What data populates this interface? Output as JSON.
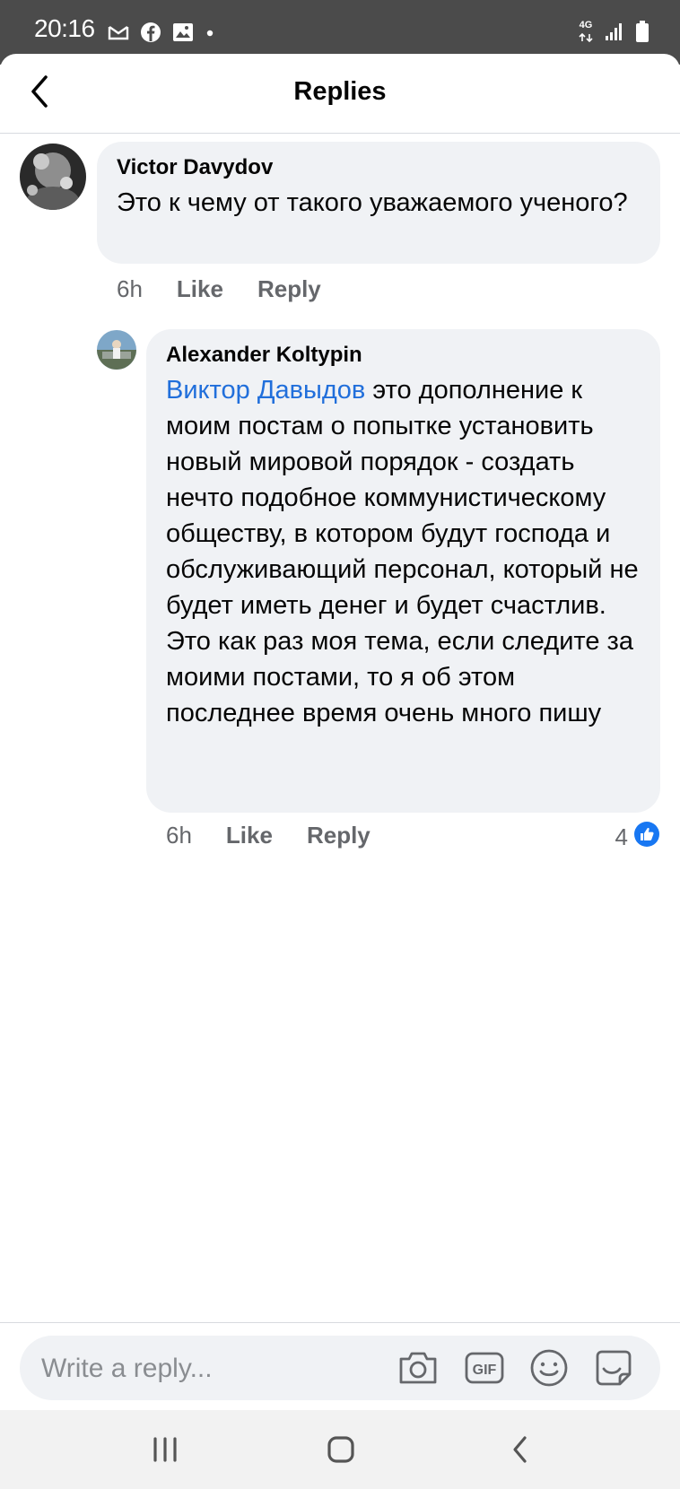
{
  "status_bar": {
    "time": "20:16",
    "network_label": "4G",
    "icons": [
      "gmail-icon",
      "facebook-icon",
      "gallery-icon",
      "dot-icon",
      "signal-icon",
      "battery-icon"
    ]
  },
  "header": {
    "title": "Replies",
    "back_icon": "chevron-left-icon"
  },
  "comments": [
    {
      "author": "Victor Davydov",
      "text": "Это к чему от такого уважаемого ученого?",
      "time": "6h",
      "like_label": "Like",
      "reply_label": "Reply"
    },
    {
      "author": "Alexander Koltypin",
      "mention": "Виктор Давыдов",
      "text": "это дополнение к моим постам о попытке установить новый мировой порядок - создать нечто подобное коммунистическому обществу, в котором будут господа и обслуживающий персонал, который не будет иметь денег и будет счастлив. Это как раз моя тема, если следите за моими постами, то я об этом последнее время очень много пишу",
      "time": "6h",
      "like_label": "Like",
      "reply_label": "Reply",
      "reaction_count": "4",
      "reaction_icon": "like-reaction-icon"
    }
  ],
  "composer": {
    "placeholder": "Write a reply...",
    "icons": [
      "camera-icon",
      "gif-icon",
      "emoji-icon",
      "sticker-icon"
    ]
  },
  "nav_bar": {
    "icons": [
      "recent-apps-icon",
      "home-icon",
      "back-icon"
    ]
  },
  "colors": {
    "status_bar": "#4b4b4b",
    "bubble": "#f0f2f5",
    "mention": "#216fdb",
    "like_blue": "#1877f2",
    "secondary_text": "#65676b"
  }
}
